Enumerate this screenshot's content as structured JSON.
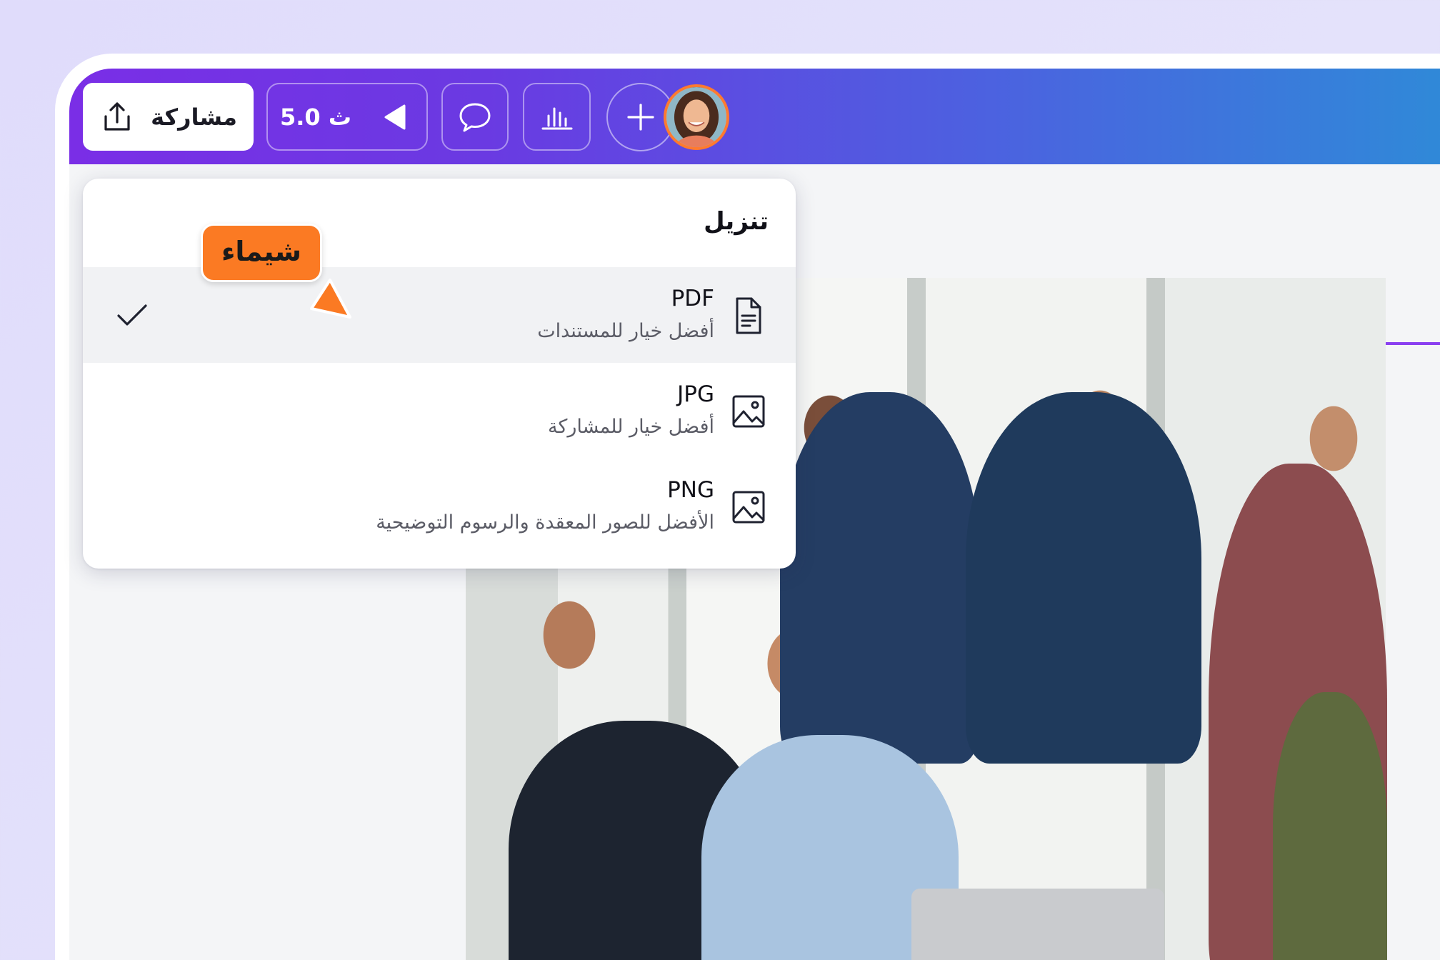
{
  "toolbar": {
    "share_label": "مشاركة",
    "present_label": "5.0 ث"
  },
  "download_menu": {
    "title": "تنزيل",
    "items": [
      {
        "name": "PDF",
        "description": "أفضل خيار للمستندات",
        "icon": "document-icon",
        "selected": true
      },
      {
        "name": "JPG",
        "description": "أفضل خيار للمشاركة",
        "icon": "image-icon",
        "selected": false
      },
      {
        "name": "PNG",
        "description": "الأفضل للصور المعقدة والرسوم التوضيحية",
        "icon": "image-icon",
        "selected": false
      }
    ]
  },
  "collaborator": {
    "cursor_label": "شيماء",
    "cursor_color": "#fb7a23"
  },
  "colors": {
    "accent": "#7a2ee6",
    "topbar_gradient_end": "#2f8ad8"
  }
}
